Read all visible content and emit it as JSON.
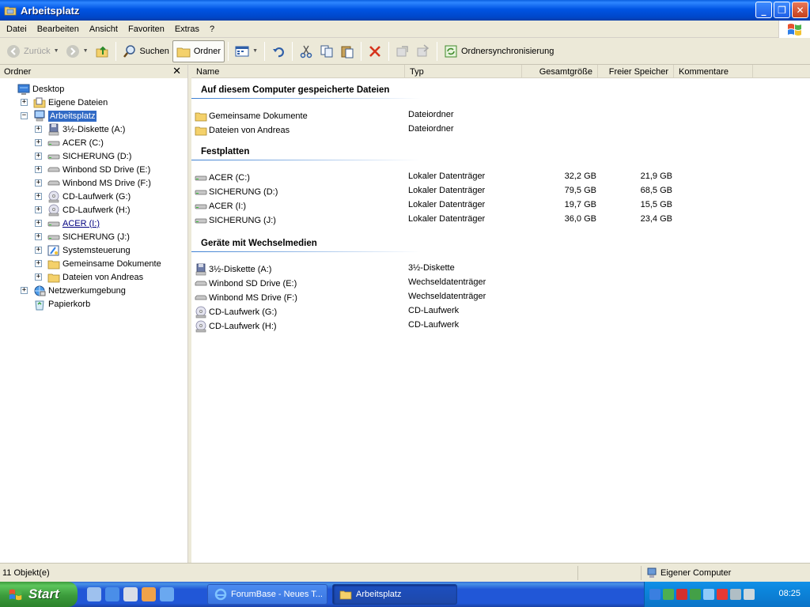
{
  "window": {
    "title": "Arbeitsplatz",
    "buttons": {
      "minimize": "_",
      "maximize": "❐",
      "close": "✕"
    }
  },
  "menu": [
    "Datei",
    "Bearbeiten",
    "Ansicht",
    "Favoriten",
    "Extras",
    "?"
  ],
  "toolbar": {
    "back": "Zurück",
    "search": "Suchen",
    "folders": "Ordner",
    "sync": "Ordnersynchronisierung"
  },
  "folder_pane": {
    "title": "Ordner",
    "close": "✕",
    "tree": [
      {
        "label": "Desktop",
        "icon": "desktop-icon",
        "level": 0,
        "expander": ""
      },
      {
        "label": "Eigene Dateien",
        "icon": "my-documents-icon",
        "level": 1,
        "expander": "+"
      },
      {
        "label": "Arbeitsplatz",
        "icon": "my-computer-icon",
        "level": 1,
        "expander": "−",
        "selected": true
      },
      {
        "label": "3½-Diskette (A:)",
        "icon": "floppy-icon",
        "level": 2,
        "expander": "+"
      },
      {
        "label": "ACER (C:)",
        "icon": "hard-drive-icon",
        "level": 2,
        "expander": "+"
      },
      {
        "label": "SICHERUNG (D:)",
        "icon": "hard-drive-icon",
        "level": 2,
        "expander": "+"
      },
      {
        "label": "Winbond SD Drive (E:)",
        "icon": "removable-drive-icon",
        "level": 2,
        "expander": "+"
      },
      {
        "label": "Winbond MS Drive (F:)",
        "icon": "removable-drive-icon",
        "level": 2,
        "expander": "+"
      },
      {
        "label": "CD-Laufwerk (G:)",
        "icon": "cd-drive-icon",
        "level": 2,
        "expander": "+"
      },
      {
        "label": "CD-Laufwerk (H:)",
        "icon": "cd-drive-icon",
        "level": 2,
        "expander": "+"
      },
      {
        "label": "ACER (I:)",
        "icon": "hard-drive-icon",
        "level": 2,
        "expander": "+",
        "underlined": true
      },
      {
        "label": "SICHERUNG (J:)",
        "icon": "hard-drive-icon",
        "level": 2,
        "expander": "+"
      },
      {
        "label": "Systemsteuerung",
        "icon": "control-panel-icon",
        "level": 2,
        "expander": "+"
      },
      {
        "label": "Gemeinsame Dokumente",
        "icon": "folder-icon",
        "level": 2,
        "expander": "+"
      },
      {
        "label": "Dateien von Andreas",
        "icon": "folder-icon",
        "level": 2,
        "expander": "+"
      },
      {
        "label": "Netzwerkumgebung",
        "icon": "network-icon",
        "level": 1,
        "expander": "+"
      },
      {
        "label": "Papierkorb",
        "icon": "recycle-bin-icon",
        "level": 1,
        "expander": ""
      }
    ]
  },
  "columns": [
    "Name",
    "Typ",
    "Gesamtgröße",
    "Freier Speicher",
    "Kommentare"
  ],
  "groups": [
    {
      "title": "Auf diesem Computer gespeicherte Dateien",
      "items": [
        {
          "name": "Gemeinsame Dokumente",
          "type": "Dateiordner",
          "total": "",
          "free": "",
          "icon": "folder-icon"
        },
        {
          "name": "Dateien von Andreas",
          "type": "Dateiordner",
          "total": "",
          "free": "",
          "icon": "folder-icon"
        }
      ]
    },
    {
      "title": "Festplatten",
      "items": [
        {
          "name": "ACER (C:)",
          "type": "Lokaler Datenträger",
          "total": "32,2 GB",
          "free": "21,9 GB",
          "icon": "hard-drive-icon"
        },
        {
          "name": "SICHERUNG (D:)",
          "type": "Lokaler Datenträger",
          "total": "79,5 GB",
          "free": "68,5 GB",
          "icon": "hard-drive-icon"
        },
        {
          "name": "ACER (I:)",
          "type": "Lokaler Datenträger",
          "total": "19,7 GB",
          "free": "15,5 GB",
          "icon": "hard-drive-icon"
        },
        {
          "name": "SICHERUNG (J:)",
          "type": "Lokaler Datenträger",
          "total": "36,0 GB",
          "free": "23,4 GB",
          "icon": "hard-drive-icon"
        }
      ]
    },
    {
      "title": "Geräte mit Wechselmedien",
      "items": [
        {
          "name": "3½-Diskette (A:)",
          "type": "3½-Diskette",
          "total": "",
          "free": "",
          "icon": "floppy-icon"
        },
        {
          "name": "Winbond SD Drive (E:)",
          "type": "Wechseldatenträger",
          "total": "",
          "free": "",
          "icon": "removable-drive-icon"
        },
        {
          "name": "Winbond MS Drive (F:)",
          "type": "Wechseldatenträger",
          "total": "",
          "free": "",
          "icon": "removable-drive-icon"
        },
        {
          "name": "CD-Laufwerk (G:)",
          "type": "CD-Laufwerk",
          "total": "",
          "free": "",
          "icon": "cd-drive-icon"
        },
        {
          "name": "CD-Laufwerk (H:)",
          "type": "CD-Laufwerk",
          "total": "",
          "free": "",
          "icon": "cd-drive-icon"
        }
      ]
    }
  ],
  "status": {
    "count": "11 Objekt(e)",
    "zone": "Eigener Computer"
  },
  "taskbar": {
    "start": "Start",
    "tasks": [
      "ForumBase - Neues T...",
      "Arbeitsplatz"
    ],
    "clock": "08:25"
  },
  "colors": {
    "titlebar": "#0054e3",
    "selection": "#316ac5",
    "taskbar": "#2157d7",
    "start": "#3b9b3b",
    "tray": "#0c84da",
    "group_line": "#3c7fd1"
  }
}
